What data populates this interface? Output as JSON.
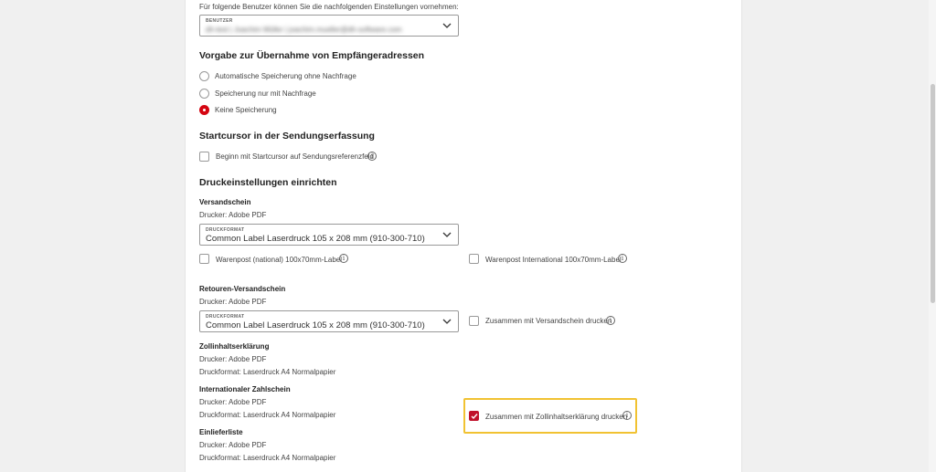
{
  "intro_text": "Für folgende Benutzer können Sie die nachfolgenden Einstellungen vornehmen:",
  "user_select": {
    "label": "BENUTZER",
    "value": "dh-test | Joachim Müller | joachim.mueller@dh-software.com"
  },
  "address": {
    "title": "Vorgabe zur Übernahme von Empfängeradressen",
    "options": [
      {
        "label": "Automatische Speicherung ohne Nachfrage",
        "selected": false
      },
      {
        "label": "Speicherung nur mit Nachfrage",
        "selected": false
      },
      {
        "label": "Keine Speicherung",
        "selected": true
      }
    ]
  },
  "cursor": {
    "title": "Startcursor in der Sendungserfassung",
    "checkbox_label": "Beginn mit Startcursor auf Sendungsreferenzfeld"
  },
  "print": {
    "title": "Druckeinstellungen einrichten",
    "versandschein": {
      "title": "Versandschein",
      "printer": "Drucker: Adobe PDF",
      "format_label": "DRUCKFORMAT",
      "format_value": "Common Label Laserdruck 105 x 208 mm (910-300-710)",
      "cb_national": "Warenpost (national) 100x70mm-Label",
      "cb_international": "Warenpost International 100x70mm-Label"
    },
    "retouren": {
      "title": "Retouren-Versandschein",
      "printer": "Drucker: Adobe PDF",
      "format_label": "DRUCKFORMAT",
      "format_value": "Common Label Laserdruck 105 x 208 mm (910-300-710)",
      "cb_label": "Zusammen mit Versandschein drucken"
    },
    "zoll": {
      "title": "Zollinhaltserklärung",
      "printer": "Drucker: Adobe PDF",
      "format": "Druckformat: Laserdruck A4 Normalpapier"
    },
    "zahlschein": {
      "title": "Internationaler Zahlschein",
      "printer": "Drucker: Adobe PDF",
      "format": "Druckformat: Laserdruck A4 Normalpapier",
      "cb_label": "Zusammen mit Zollinhaltserklärung drucken"
    },
    "einliefer": {
      "title": "Einlieferliste",
      "printer": "Drucker: Adobe PDF",
      "format": "Druckformat: Laserdruck A4 Normalpapier"
    }
  },
  "info_glyph": "i",
  "colors": {
    "accent_red": "#d40511",
    "highlight": "#f1c232"
  }
}
